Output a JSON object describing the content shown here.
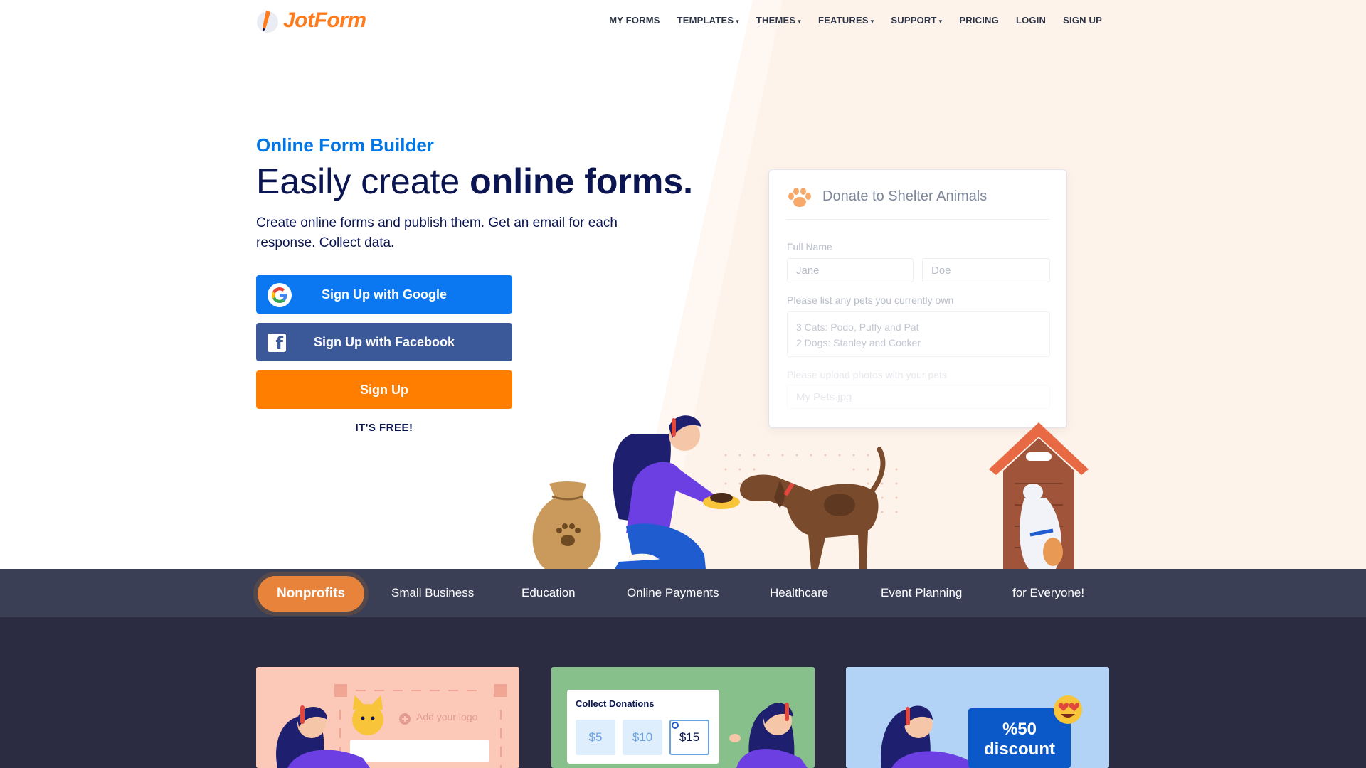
{
  "header": {
    "logo_text": "JotForm",
    "nav": [
      {
        "label": "MY FORMS",
        "has_caret": false
      },
      {
        "label": "TEMPLATES",
        "has_caret": true
      },
      {
        "label": "THEMES",
        "has_caret": true
      },
      {
        "label": "FEATURES",
        "has_caret": true
      },
      {
        "label": "SUPPORT",
        "has_caret": true
      },
      {
        "label": "PRICING",
        "has_caret": false
      },
      {
        "label": "LOGIN",
        "has_caret": false
      },
      {
        "label": "SIGN UP",
        "has_caret": false
      }
    ],
    "caret": "▾"
  },
  "hero": {
    "eyebrow": "Online Form Builder",
    "headline_light": "Easily create ",
    "headline_bold": "online forms.",
    "subcopy": "Create online forms and publish them. Get an email for each response. Collect data.",
    "google_button": "Sign Up with Google",
    "facebook_button": "Sign Up with Facebook",
    "signup_button": "Sign Up",
    "free_note": "IT'S FREE!"
  },
  "donate_card": {
    "title": "Donate to Shelter Animals",
    "full_name_label": "Full Name",
    "first_name": "Jane",
    "last_name": "Doe",
    "pets_label": "Please list any pets you currently own",
    "pets_line1": "3 Cats: Podo, Puffy and Pat",
    "pets_line2": "2 Dogs: Stanley and Cooker",
    "upload_label": "Please upload photos with your pets",
    "upload_value": "My Pets.jpg"
  },
  "categories": {
    "active": "Nonprofits",
    "items": [
      "Small Business",
      "Education",
      "Online Payments",
      "Healthcare",
      "Event Planning",
      "for Everyone!"
    ]
  },
  "tiles": {
    "logo_placeholder": "Add your logo",
    "donations_title": "Collect Donations",
    "amounts": [
      "$5",
      "$10",
      "$15"
    ],
    "discount_line1": "%50",
    "discount_line2": "discount"
  },
  "colors": {
    "brand_orange": "#ff7e00",
    "google_blue": "#0b78f1",
    "facebook_blue": "#3b5998",
    "eyebrow_blue": "#0075e3",
    "navy": "#0a1551",
    "category_bar": "#3b3f56",
    "active_category": "#e8833c"
  }
}
